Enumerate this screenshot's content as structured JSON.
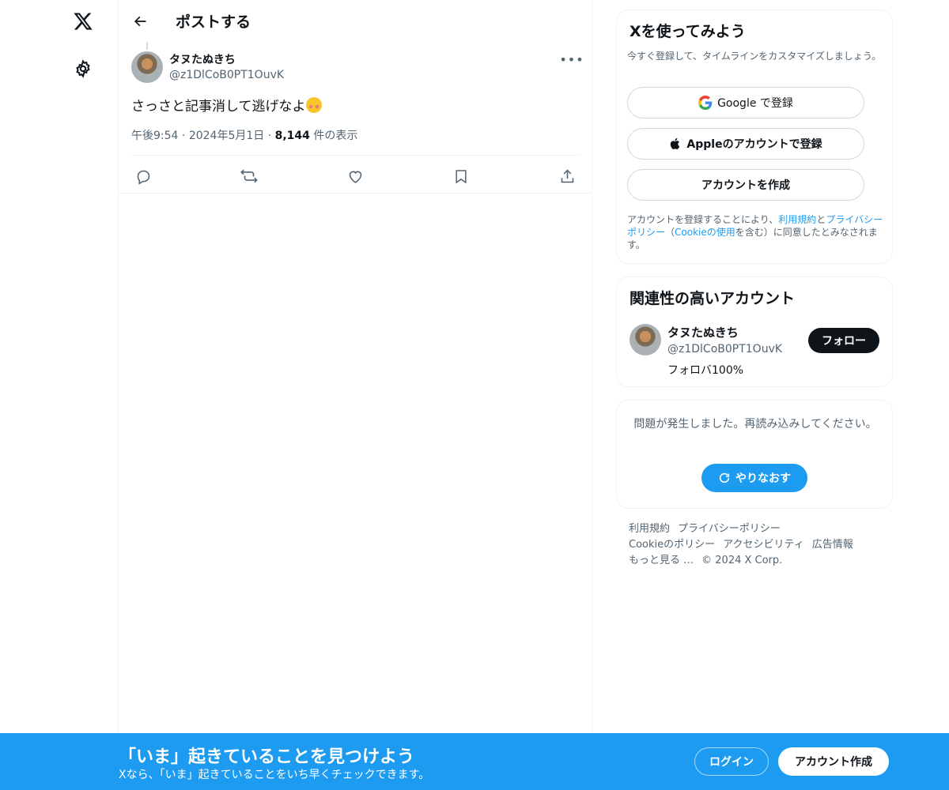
{
  "nav": {
    "logo_icon": "x-logo-icon",
    "settings_icon": "gear-icon"
  },
  "header": {
    "title": "ポストする"
  },
  "post": {
    "author_name": "タヌたぬきち",
    "author_handle": "@z1DlCoB0PT1OuvK",
    "text": "さっさと記事消して逃げなよ",
    "emoji": "smiling-face-with-blush",
    "time": "午後9:54",
    "date": "2024年5月1日",
    "views_count": "8,144",
    "views_label": "件の表示",
    "separator": "·"
  },
  "signup_card": {
    "title": "Xを使ってみよう",
    "subtitle": "今すぐ登録して、タイムラインをカスタマイズしましょう。",
    "google_label": "Google で登録",
    "apple_label": "Appleのアカウントで登録",
    "create_label": "アカウントを作成",
    "legal_prefix": "アカウントを登録することにより、",
    "terms_link": "利用規約",
    "and": "と",
    "privacy_link": "プライバシーポリシー",
    "paren_open": "（",
    "cookie_link": "Cookieの使用",
    "legal_suffix": "を含む）に同意したとみなされます。"
  },
  "related_card": {
    "title": "関連性の高いアカウント",
    "name": "タヌたぬきち",
    "handle": "@z1DlCoB0PT1OuvK",
    "bio": "フォロバ100%",
    "follow_label": "フォロー"
  },
  "error_card": {
    "message": "問題が発生しました。再読み込みしてください。",
    "retry_label": "やりなおす"
  },
  "footer": {
    "links": [
      "利用規約",
      "プライバシーポリシー",
      "Cookieのポリシー",
      "アクセシビリティ",
      "広告情報",
      "もっと見る …"
    ],
    "copyright": "© 2024 X Corp."
  },
  "bottom_bar": {
    "title": "「いま」起きていることを見つけよう",
    "subtitle": "Xなら、「いま」起きていることをいち早くチェックできます。",
    "login_label": "ログイン",
    "signup_label": "アカウント作成"
  },
  "colors": {
    "accent": "#1d9bf0",
    "text": "#0f1419",
    "secondary": "#536471",
    "border": "#eff3f4"
  }
}
